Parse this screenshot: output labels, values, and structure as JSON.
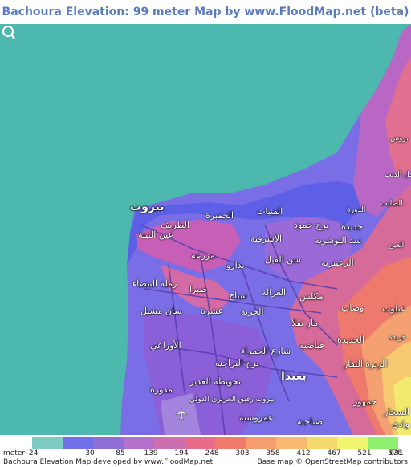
{
  "title": "Bachoura Elevation: 99 meter Map by www.FloodMap.net (beta)",
  "close_icon": "close-icon",
  "map": {
    "sea_color": "#4cb8ae",
    "places": [
      {
        "name": "بيروت",
        "size": "big"
      },
      {
        "name": "عين التينة",
        "size": "md"
      },
      {
        "name": "الطريف",
        "size": "md"
      },
      {
        "name": "الحمبرة",
        "size": "md"
      },
      {
        "name": "القنيات",
        "size": "md"
      },
      {
        "name": "برج حمود",
        "size": "md"
      },
      {
        "name": "الأشرفية",
        "size": "md"
      },
      {
        "name": "مزرعة",
        "size": "md"
      },
      {
        "name": "بدارو",
        "size": "md"
      },
      {
        "name": "سن الفيل",
        "size": "md"
      },
      {
        "name": "سد البوشرية",
        "size": "md"
      },
      {
        "name": "جديدة",
        "size": "md"
      },
      {
        "name": "الزعيترية",
        "size": "md"
      },
      {
        "name": "رملة البيضاء",
        "size": "md"
      },
      {
        "name": "صبرا",
        "size": "md"
      },
      {
        "name": "شياح",
        "size": "md"
      },
      {
        "name": "الغزالة",
        "size": "md"
      },
      {
        "name": "عشرة",
        "size": "md"
      },
      {
        "name": "الخريه",
        "size": "md"
      },
      {
        "name": "سان مشيل",
        "size": "md"
      },
      {
        "name": "مكلس",
        "size": "md"
      },
      {
        "name": "وصاب",
        "size": "md"
      },
      {
        "name": "عيلوت",
        "size": "md"
      },
      {
        "name": "الأوزاعي",
        "size": "md"
      },
      {
        "name": "مار تقلا",
        "size": "md"
      },
      {
        "name": "الحديدة",
        "size": "md"
      },
      {
        "name": "شارع الحمراء",
        "size": "md"
      },
      {
        "name": "فياضية",
        "size": "md"
      },
      {
        "name": "برج البراجنة",
        "size": "md"
      },
      {
        "name": "الزيرة",
        "size": "md"
      },
      {
        "name": "بعبدا",
        "size": "big"
      },
      {
        "name": "تحويطة الغدير",
        "size": "md"
      },
      {
        "name": "مدورة",
        "size": "md"
      },
      {
        "name": "عمروسية",
        "size": "md"
      },
      {
        "name": "صباحية",
        "size": "md"
      },
      {
        "name": "جمهور",
        "size": "md"
      },
      {
        "name": "السحار",
        "size": "md"
      },
      {
        "name": "وادي",
        "size": "md"
      },
      {
        "name": "النقار",
        "size": "md"
      },
      {
        "name": "بروس",
        "size": "sm"
      },
      {
        "name": "جل الديب",
        "size": "sm"
      },
      {
        "name": "الدورة",
        "size": "sm"
      },
      {
        "name": "العين",
        "size": "sm"
      },
      {
        "name": "الصليب",
        "size": "sm"
      },
      {
        "name": "فريدة",
        "size": "sm"
      },
      {
        "name": "بيروت رفيق الحريري الدولي",
        "size": "sm"
      }
    ],
    "marker_icon": "location-pin-icon",
    "airport_icon": "airplane-icon"
  },
  "legend": {
    "unit": "meter",
    "ticks": [
      "-24",
      "30",
      "85",
      "139",
      "194",
      "248",
      "303",
      "358",
      "412",
      "467",
      "521",
      "576",
      "631"
    ],
    "colors": [
      "#7ecbc4",
      "#7070e8",
      "#8f6fd6",
      "#b56fcc",
      "#cc6fb0",
      "#e86c8a",
      "#f07a6c",
      "#f59c70",
      "#f7b870",
      "#f4d96e",
      "#f1f46e",
      "#8ef06e",
      "#70e05a"
    ]
  },
  "credits": {
    "left": "Bachoura Elevation Map developed by www.FloodMap.net",
    "right": "Base map © OpenStreetMap contributors"
  }
}
